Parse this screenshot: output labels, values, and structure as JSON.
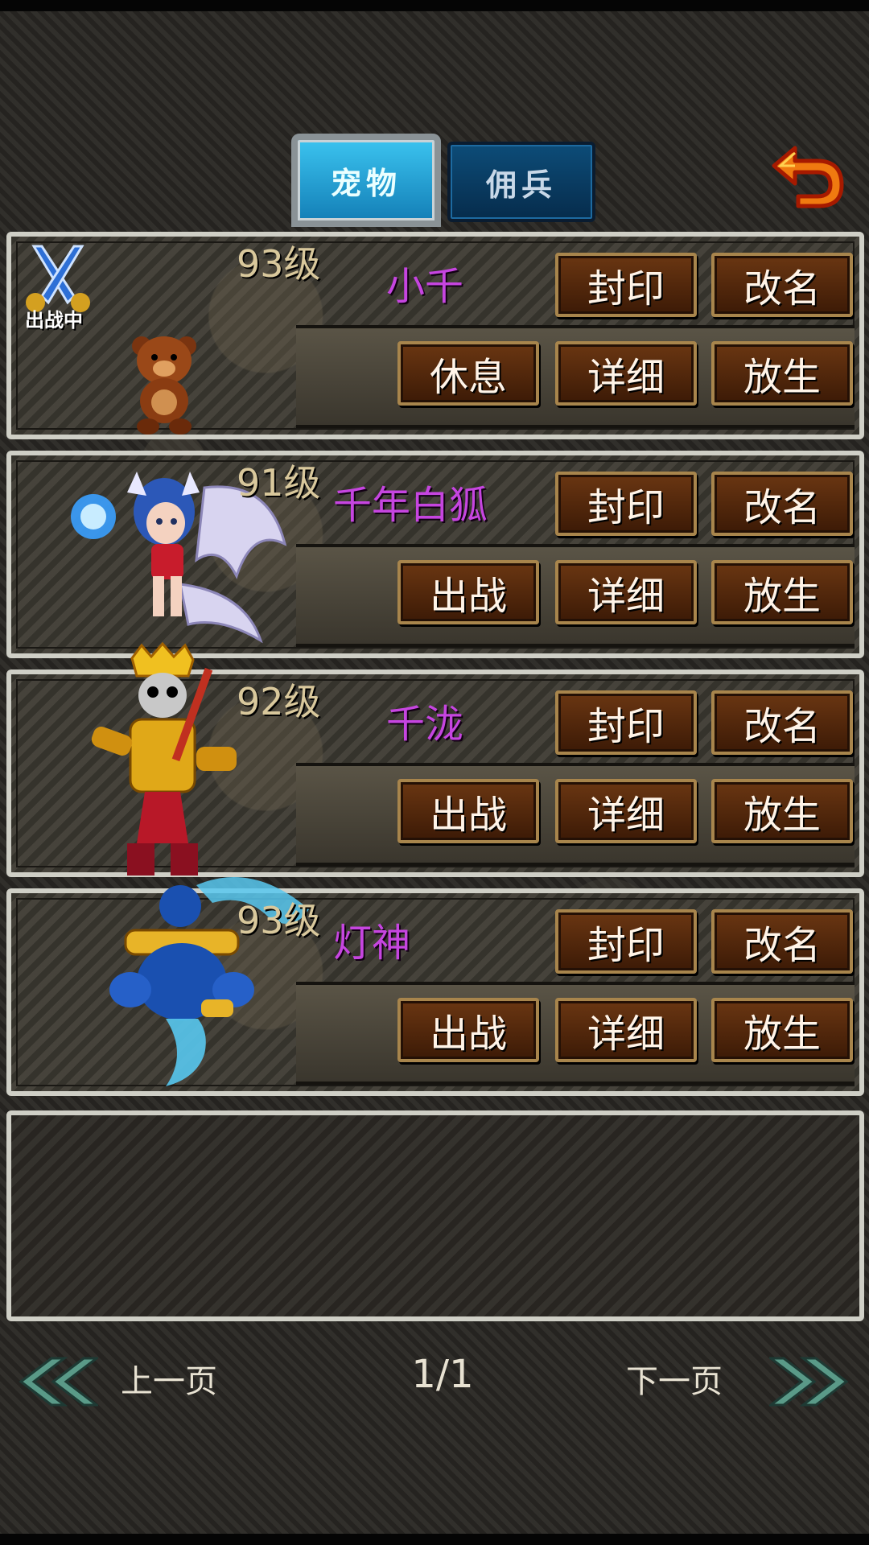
{
  "tabs": [
    {
      "label": "宠物",
      "active": true
    },
    {
      "label": "佣兵",
      "active": false
    }
  ],
  "back_icon": "return-arrow-icon",
  "pets": [
    {
      "level": "93级",
      "name": "小千",
      "in_battle": true,
      "battle_badge": "出战中",
      "buttons": [
        "封印",
        "改名",
        "休息",
        "详细",
        "放生"
      ]
    },
    {
      "level": "91级",
      "name": "千年白狐",
      "in_battle": false,
      "buttons": [
        "封印",
        "改名",
        "出战",
        "详细",
        "放生"
      ]
    },
    {
      "level": "92级",
      "name": "千泷",
      "in_battle": false,
      "buttons": [
        "封印",
        "改名",
        "出战",
        "详细",
        "放生"
      ]
    },
    {
      "level": "93级",
      "name": "灯神",
      "in_battle": false,
      "buttons": [
        "封印",
        "改名",
        "出战",
        "详细",
        "放生"
      ]
    }
  ],
  "pager": {
    "prev_label": "上一页",
    "next_label": "下一页",
    "page": "1/1"
  },
  "colors": {
    "pet_name": "#c645e0",
    "level": "#d9c89c",
    "tab_active": "#1fa3dc"
  }
}
